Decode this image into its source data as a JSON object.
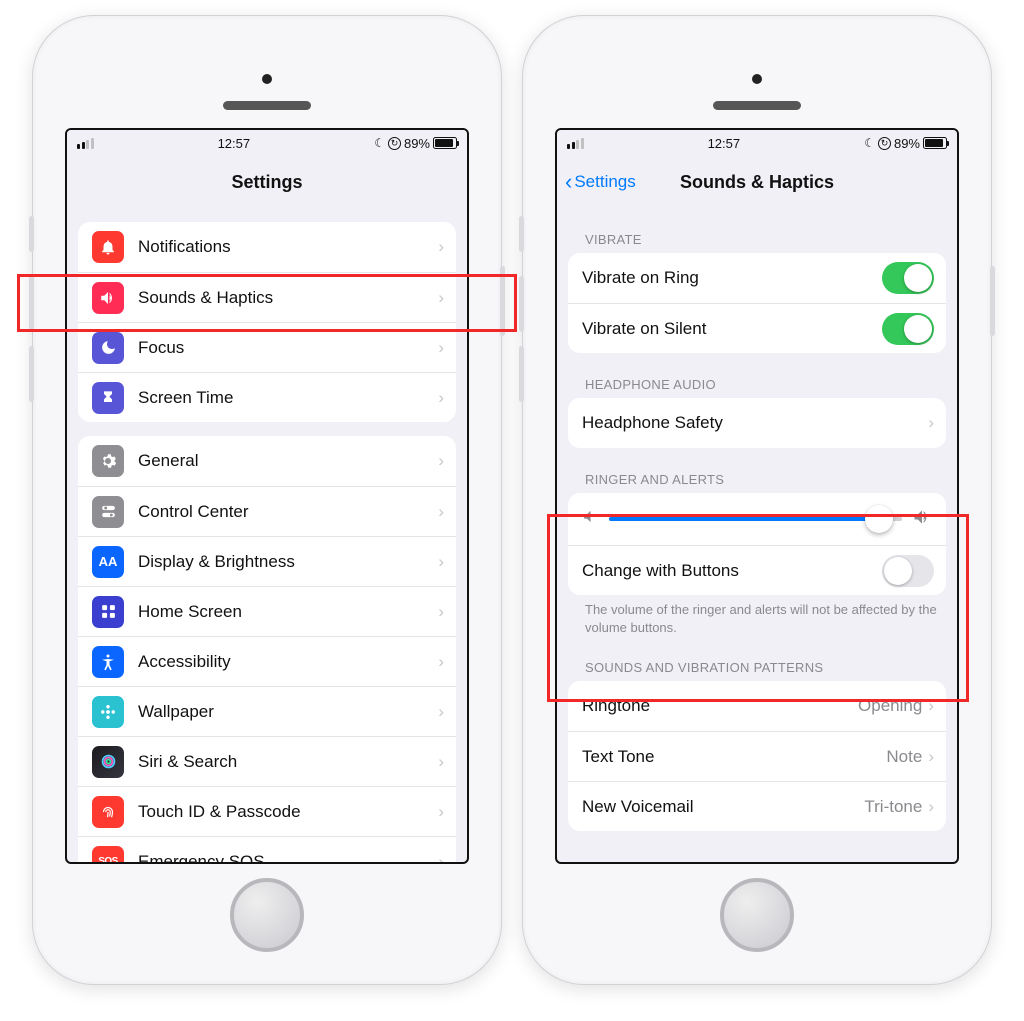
{
  "status": {
    "time": "12:57",
    "battery_pct": "89%",
    "lock_glyph": "↻",
    "moon": "☾"
  },
  "left": {
    "title": "Settings",
    "group1": [
      {
        "name": "notifications",
        "label": "Notifications",
        "color": "#fe3a30"
      },
      {
        "name": "sounds-haptics",
        "label": "Sounds & Haptics",
        "color": "#ff2d55"
      },
      {
        "name": "focus",
        "label": "Focus",
        "color": "#5856d6"
      },
      {
        "name": "screen-time",
        "label": "Screen Time",
        "color": "#5856d6"
      }
    ],
    "group2": [
      {
        "name": "general",
        "label": "General",
        "color": "#8e8e93"
      },
      {
        "name": "control-center",
        "label": "Control Center",
        "color": "#8e8e93"
      },
      {
        "name": "display-brightness",
        "label": "Display & Brightness",
        "color": "#0a66ff"
      },
      {
        "name": "home-screen",
        "label": "Home Screen",
        "color": "#3b3fcf"
      },
      {
        "name": "accessibility",
        "label": "Accessibility",
        "color": "#0a66ff"
      },
      {
        "name": "wallpaper",
        "label": "Wallpaper",
        "color": "#2ac1d1"
      },
      {
        "name": "siri-search",
        "label": "Siri & Search",
        "color": "#1f1f1f"
      },
      {
        "name": "touchid-passcode",
        "label": "Touch ID & Passcode",
        "color": "#fe3a30"
      },
      {
        "name": "emergency-sos",
        "label": "Emergency SOS",
        "color": "#fe3a30"
      }
    ]
  },
  "right": {
    "back_label": "Settings",
    "title": "Sounds & Haptics",
    "vibrate_header": "VIBRATE",
    "vibrate_ring": {
      "label": "Vibrate on Ring",
      "on": true
    },
    "vibrate_silent": {
      "label": "Vibrate on Silent",
      "on": true
    },
    "headphone_header": "HEADPHONE AUDIO",
    "headphone_safety": "Headphone Safety",
    "ringer_header": "RINGER AND ALERTS",
    "ringer_volume_pct": 92,
    "change_buttons": {
      "label": "Change with Buttons",
      "on": false
    },
    "ringer_footer": "The volume of the ringer and alerts will not be affected by the volume buttons.",
    "patterns_header": "SOUNDS AND VIBRATION PATTERNS",
    "patterns": [
      {
        "name": "ringtone",
        "label": "Ringtone",
        "value": "Opening"
      },
      {
        "name": "text-tone",
        "label": "Text Tone",
        "value": "Note"
      },
      {
        "name": "new-voicemail",
        "label": "New Voicemail",
        "value": "Tri-tone"
      }
    ]
  }
}
